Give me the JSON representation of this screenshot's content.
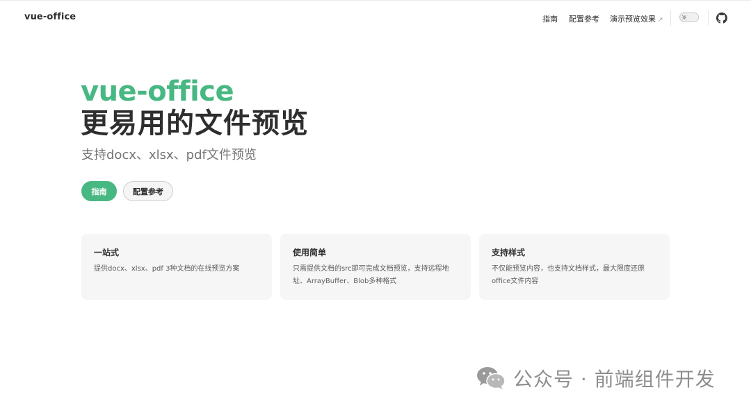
{
  "navbar": {
    "title": "vue-office",
    "links": [
      {
        "label": "指南"
      },
      {
        "label": "配置参考"
      },
      {
        "label": "演示预览效果",
        "external_icon": "↗"
      }
    ],
    "theme_toggle_icon": "sun-icon",
    "social_icon": "github-icon"
  },
  "hero": {
    "name": "vue-office",
    "text": "更易用的文件预览",
    "tagline": "支持docx、xlsx、pdf文件预览",
    "actions": [
      {
        "label": "指南",
        "theme": "brand"
      },
      {
        "label": "配置参考",
        "theme": "alt"
      }
    ]
  },
  "features": [
    {
      "title": "一站式",
      "details": "提供docx、xlsx、pdf 3种文档的在线预览方案"
    },
    {
      "title": "使用简单",
      "details": "只需提供文档的src即可完成文档预览，支持远程地址、ArrayBuffer、Blob多种格式"
    },
    {
      "title": "支持样式",
      "details": "不仅能预览内容，也支持文档样式，最大限度还原office文件内容"
    }
  ],
  "watermark": {
    "text": "公众号 · 前端组件开发",
    "icon": "wechat-icon"
  },
  "colors": {
    "brand": "#48b883",
    "text": "#2e2e2e",
    "muted": "#737373",
    "card_bg": "#f6f6f7"
  }
}
